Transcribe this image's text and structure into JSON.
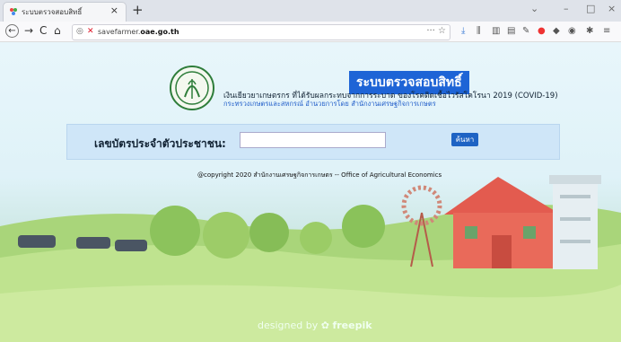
{
  "browser": {
    "tab_title": "ระบบตรวจสอบสิทธิ์",
    "tab_close": "×",
    "new_tab": "+",
    "nav": {
      "back": "←",
      "forward": "→",
      "reload": "C",
      "home": "⌂"
    },
    "url_prefix": "savefarmer.",
    "url_domain": "oae.go.th",
    "url_actions": "··· ☆",
    "window_controls": {
      "dropdown": "⌄",
      "minimize": "–",
      "maximize": "□",
      "close": "×"
    }
  },
  "header": {
    "brand": "ระบบตรวจสอบสิทธิ์",
    "subtitle": "เงินเยียวยาเกษตรกร ที่ได้รับผลกระทบจากการระบาด ของโรคติดเชื้อไวรัสโคโรนา 2019 (COVID-19)",
    "department": "กระทรวงเกษตรและสหกรณ์ อำนวยการโดย สำนักงานเศรษฐกิจการเกษตร"
  },
  "form": {
    "id_label": "เลขบัตรประจำตัวประชาชน:",
    "id_value": "",
    "search_button": "ค้นหา"
  },
  "footer": {
    "copyright": "@copyright 2020 สำนักงานเศรษฐกิจการเกษตร -- Office of Agricultural Economics",
    "designed_by": "designed by",
    "freepik": "freepik"
  },
  "colors": {
    "accent": "#1e64d6",
    "panel": "#cfe6f8",
    "barn_red": "#e35b4f"
  }
}
